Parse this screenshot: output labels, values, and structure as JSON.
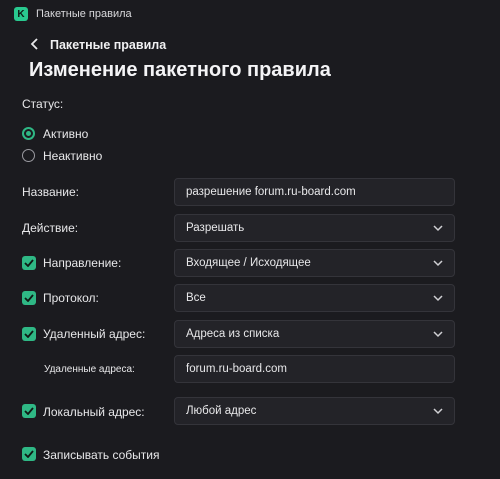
{
  "window": {
    "title": "Пакетные правила",
    "logo_letter": "K"
  },
  "nav": {
    "back_label": "Пакетные правила"
  },
  "page": {
    "title": "Изменение пакетного правила"
  },
  "status": {
    "label": "Статус:",
    "options": [
      {
        "label": "Активно",
        "selected": true
      },
      {
        "label": "Неактивно",
        "selected": false
      }
    ]
  },
  "form": {
    "name": {
      "label": "Название:",
      "value": "разрешение forum.ru-board.com"
    },
    "action": {
      "label": "Действие:",
      "value": "Разрешать"
    },
    "direction": {
      "label": "Направление:",
      "checked": true,
      "value": "Входящее / Исходящее"
    },
    "protocol": {
      "label": "Протокол:",
      "checked": true,
      "value": "Все"
    },
    "remote": {
      "label": "Удаленный адрес:",
      "checked": true,
      "value": "Адреса из списка"
    },
    "remote_list": {
      "label": "Удаленные адреса:",
      "value": "forum.ru-board.com"
    },
    "local": {
      "label": "Локальный адрес:",
      "checked": true,
      "value": "Любой адрес"
    },
    "log_events": {
      "label": "Записывать события",
      "checked": true
    }
  },
  "colors": {
    "accent": "#2fb885",
    "background": "#1b1b1f",
    "field": "#232328"
  }
}
